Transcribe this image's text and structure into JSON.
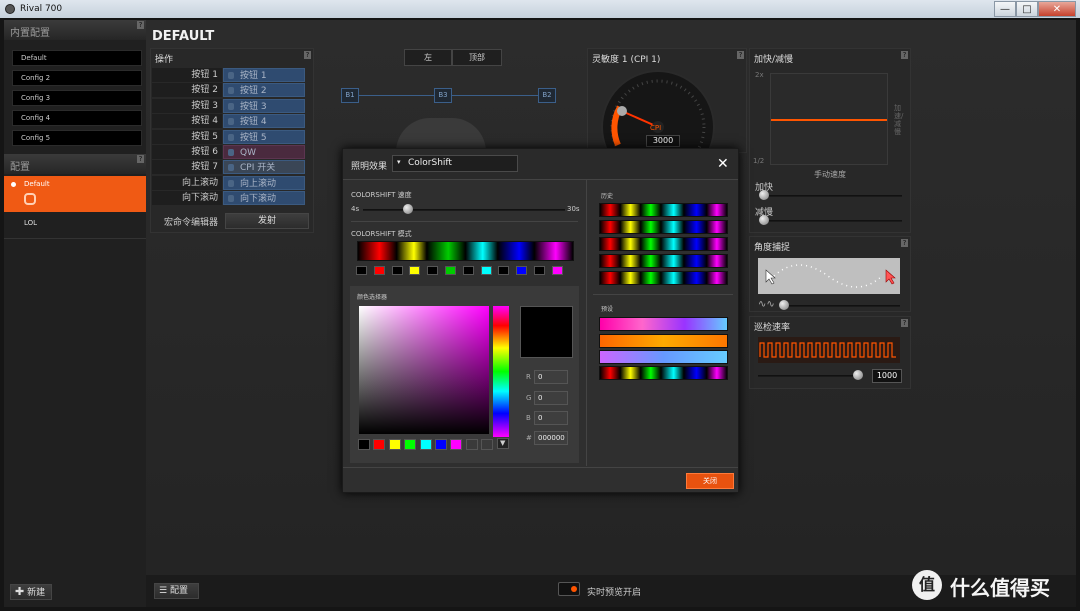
{
  "window": {
    "title": "Rival 700",
    "min": "—",
    "max": "□",
    "close": "✕"
  },
  "sidebar": {
    "builtin_header": "内置配置",
    "builtin_items": [
      "Default",
      "Config 2",
      "Config 3",
      "Config 4",
      "Config 5"
    ],
    "profiles_header": "配置",
    "profiles": [
      {
        "name": "Default",
        "active": true
      },
      {
        "name": "LOL",
        "active": false
      }
    ],
    "new_button": "新建"
  },
  "page_title": "DEFAULT",
  "actions": {
    "header": "操作",
    "rows": [
      {
        "label": "按钮 1",
        "value": "按钮 1",
        "kind": "normal"
      },
      {
        "label": "按钮 2",
        "value": "按钮 2",
        "kind": "normal"
      },
      {
        "label": "按钮 3",
        "value": "按钮 3",
        "kind": "normal"
      },
      {
        "label": "按钮 4",
        "value": "按钮 4",
        "kind": "normal"
      },
      {
        "label": "按钮 5",
        "value": "按钮 5",
        "kind": "normal"
      },
      {
        "label": "按钮 6",
        "value": "QW",
        "kind": "macro"
      },
      {
        "label": "按钮 7",
        "value": "CPI 开关",
        "kind": "cpi"
      },
      {
        "label": "向上滚动",
        "value": "向上滚动",
        "kind": "normal"
      },
      {
        "label": "向下滚动",
        "value": "向下滚动",
        "kind": "normal"
      }
    ],
    "macro_editor": "宏命令编辑器",
    "fire": "发射"
  },
  "mouse_view": {
    "tabs": [
      "左",
      "顶部"
    ],
    "labels": [
      "B1",
      "B3",
      "B2"
    ]
  },
  "sensitivity": {
    "header": "灵敏度 1 (CPI 1)",
    "gauge_label": "CPI",
    "value": "3000"
  },
  "accel": {
    "header": "加快/减慢",
    "y_top": "2x",
    "y_bottom": "1/2",
    "side_label": "加速/减慢",
    "x_label": "手动速度",
    "accel_label": "加快",
    "decel_label": "减慢"
  },
  "angle": {
    "header": "角度捕捉"
  },
  "polling": {
    "header": "巡检速率",
    "value": "1000"
  },
  "dialog": {
    "title": "照明效果",
    "effect": "ColorShift",
    "speed_label": "COLORSHIFT 速度",
    "speed_min": "4s",
    "speed_max": "30s",
    "mode_label": "COLORSHIFT 模式",
    "picker_label": "颜色选择器",
    "history_label": "历史",
    "preset_label": "预设",
    "rgb": {
      "r_label": "R",
      "g_label": "G",
      "b_label": "B",
      "hex_label": "#",
      "r": "0",
      "g": "0",
      "b": "0",
      "hex": "000000"
    },
    "close_button": "关闭",
    "swatches": [
      "#000000",
      "#ff0000",
      "#ffff00",
      "#00ff00",
      "#00ffff",
      "#0000ff",
      "#ff00ff",
      "#3a3a3a",
      "#3a3a3a"
    ],
    "stops": [
      "#000000",
      "#ff0000",
      "#000000",
      "#ffff00",
      "#000000",
      "#00cc00",
      "#000000",
      "#00ffff",
      "#000000",
      "#0000ff",
      "#000000",
      "#ff00ff"
    ]
  },
  "bottom": {
    "profile_button": "配置",
    "live_preview": "实时预览开启"
  },
  "watermark": {
    "text": "什么值得买"
  },
  "colors": {
    "accent": "#ff5500",
    "selected_profile": "#f05a14",
    "action_blue": "#2f4b70"
  }
}
